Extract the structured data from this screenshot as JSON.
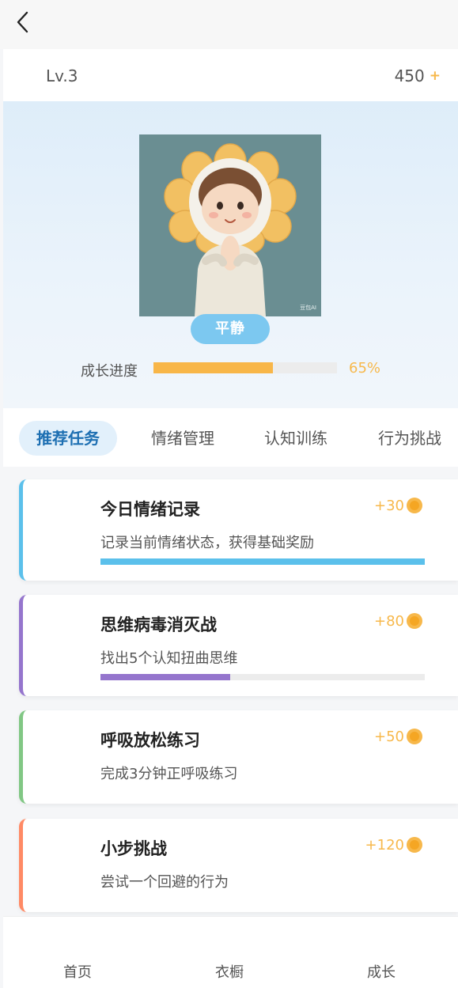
{
  "header": {
    "back_icon": "chevron-left-icon"
  },
  "level_bar": {
    "level": "Lv.3",
    "coins": "450",
    "plus": "+"
  },
  "hero": {
    "watermark": "豆包AI",
    "mood": "平静",
    "progress_label": "成长进度",
    "progress_value": 0.65,
    "progress_text": "65%",
    "colors": {
      "mood_badge": "#7cc8f0",
      "progress": "#f8b648"
    }
  },
  "tabs": [
    {
      "label": "推荐任务",
      "active": true
    },
    {
      "label": "情绪管理",
      "active": false
    },
    {
      "label": "认知训练",
      "active": false
    },
    {
      "label": "行为挑战",
      "active": false
    }
  ],
  "tasks": [
    {
      "title": "今日情绪记录",
      "desc": "记录当前情绪状态，获得基础奖励",
      "reward": "+30",
      "accent": "#5bc0eb",
      "progress": 1.0
    },
    {
      "title": "思维病毒消灭战",
      "desc": "找出5个认知扭曲思维",
      "reward": "+80",
      "accent": "#9575cd",
      "progress": 0.4
    },
    {
      "title": "呼吸放松练习",
      "desc": "完成3分钟正呼吸练习",
      "reward": "+50",
      "accent": "#81c784",
      "progress": null
    },
    {
      "title": "小步挑战",
      "desc": "尝试一个回避的行为",
      "reward": "+120",
      "accent": "#ff8a65",
      "progress": null
    }
  ],
  "bottom_nav": [
    {
      "label": "首页"
    },
    {
      "label": "衣橱"
    },
    {
      "label": "成长"
    }
  ]
}
